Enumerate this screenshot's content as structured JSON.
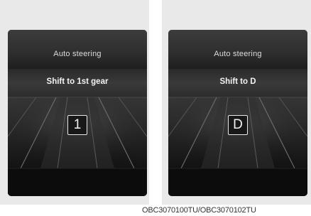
{
  "panels": [
    {
      "title": "Auto steering",
      "message": "Shift to 1st gear",
      "gear": "1"
    },
    {
      "title": "Auto steering",
      "message": "Shift to D",
      "gear": "D"
    }
  ],
  "caption": "OBC3070100TU/OBC3070102TU"
}
